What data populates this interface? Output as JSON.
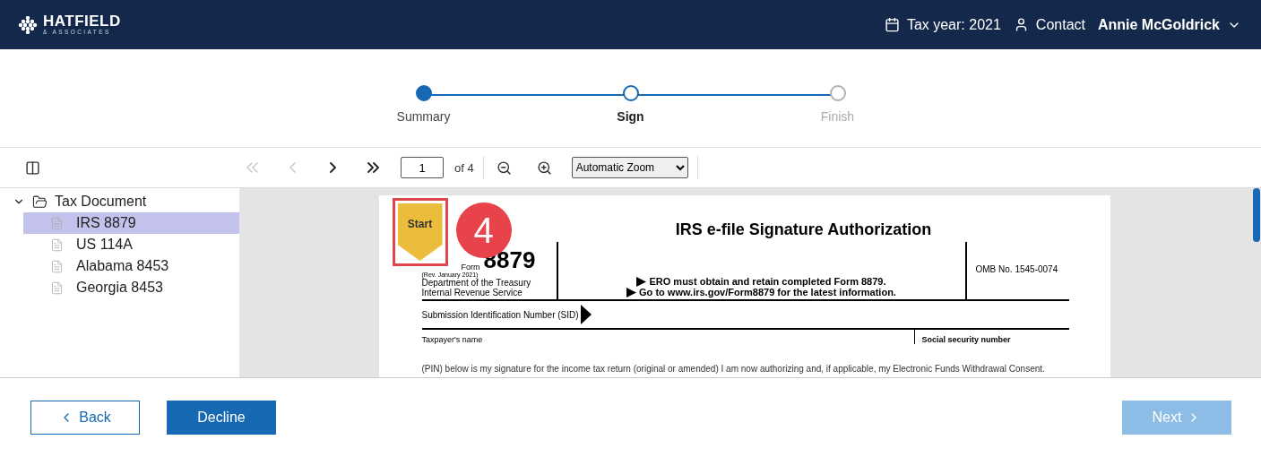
{
  "header": {
    "logo_name": "HATFIELD",
    "logo_sub": "& ASSOCIATES",
    "tax_year": "Tax year: 2021",
    "contact": "Contact",
    "user": "Annie McGoldrick"
  },
  "steps": [
    {
      "label": "Summary",
      "completed": true,
      "selected": false
    },
    {
      "label": "Sign",
      "completed": false,
      "selected": true
    },
    {
      "label": "Finish",
      "completed": false,
      "selected": false
    }
  ],
  "toolbar": {
    "nav": [
      {
        "kind": "first",
        "disabled": true
      },
      {
        "kind": "prev",
        "disabled": true
      },
      {
        "kind": "next",
        "disabled": false
      },
      {
        "kind": "last",
        "disabled": false
      }
    ],
    "page": "1",
    "page_count": "of 4",
    "zoom": "Automatic Zoom"
  },
  "tree": {
    "label": "Tax Document",
    "expanded": true,
    "children": [
      {
        "label": "IRS 8879",
        "selected": true
      },
      {
        "label": "US 114A",
        "selected": false
      },
      {
        "label": "Alabama 8453",
        "selected": false
      },
      {
        "label": "Georgia 8453",
        "selected": false
      }
    ]
  },
  "document": {
    "start_tag": {
      "label": "Start",
      "highlighted": true
    },
    "callout": "4",
    "title": "IRS e-file Signature Authorization",
    "form_label": "Form",
    "form_number": "8879",
    "revision": "(Rev. January 2021)",
    "department": [
      "Department of the Treasury",
      "Internal Revenue Service"
    ],
    "instructions": [
      "ERO must obtain and retain completed Form 8879.",
      "Go to www.irs.gov/Form8879 for the latest information."
    ],
    "omb": "OMB No. 1545-0074",
    "sid": "Submission Identification Number (SID)",
    "taxpayer": "Taxpayer's name",
    "ssn": "Social security number",
    "consent": "(PIN) below is my signature for the income tax return (original or amended) I am now authorizing and, if applicable, my Electronic Funds Withdrawal Consent."
  },
  "footer": {
    "back": "Back",
    "decline": "Decline",
    "next": "Next",
    "next_disabled": true
  }
}
